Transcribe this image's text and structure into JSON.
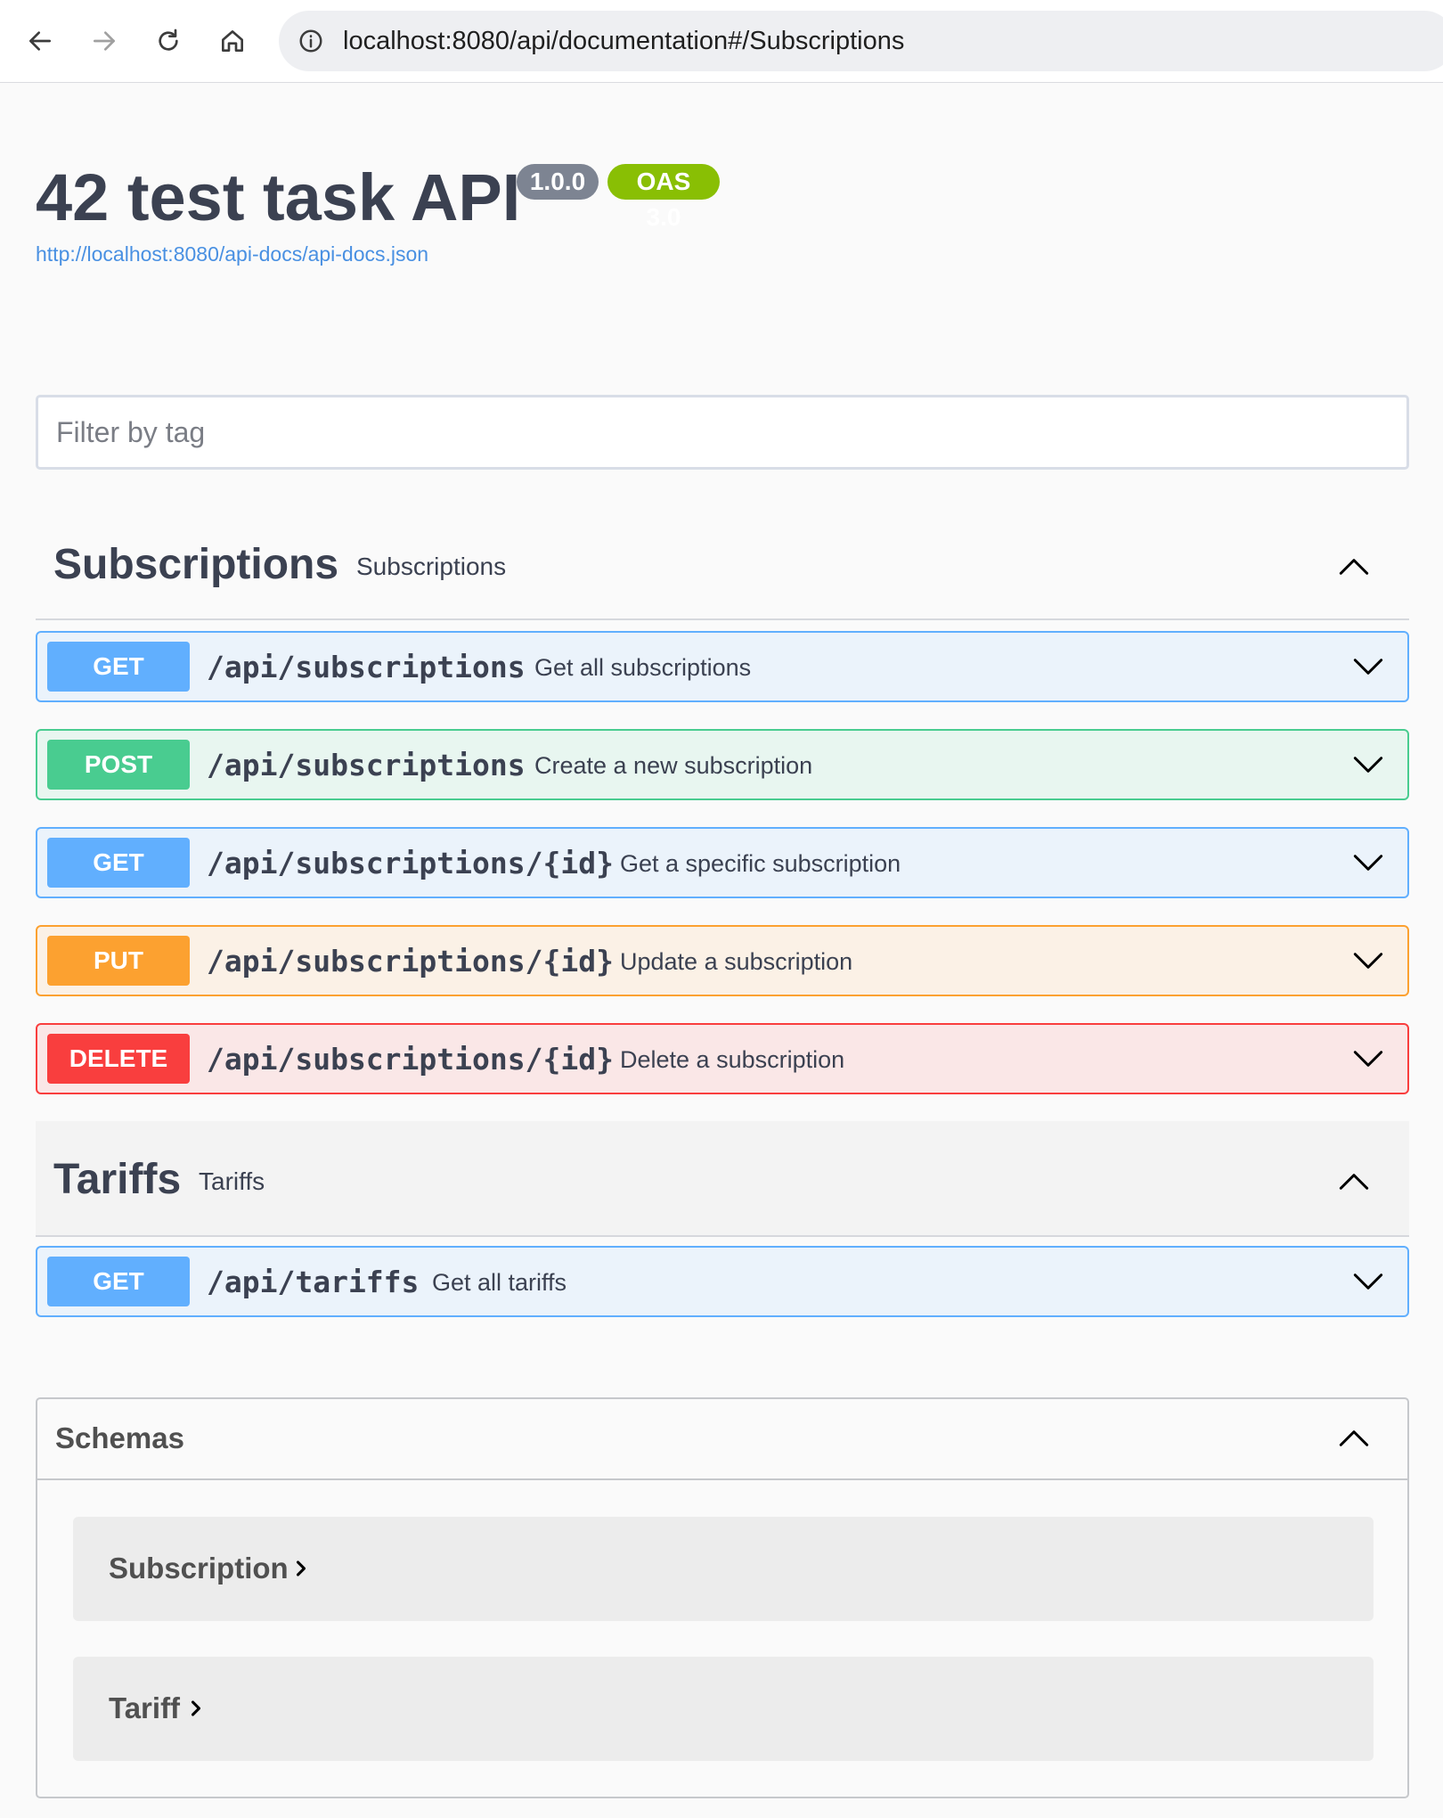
{
  "browser": {
    "url": "localhost:8080/api/documentation#/Subscriptions"
  },
  "info": {
    "title": "42 test task API",
    "version": "1.0.0",
    "oas": "OAS 3.0",
    "spec_url": "http://localhost:8080/api-docs/api-docs.json"
  },
  "filter": {
    "placeholder": "Filter by tag",
    "value": ""
  },
  "tags": [
    {
      "name": "Subscriptions",
      "description": "Subscriptions",
      "operations": [
        {
          "method": "GET",
          "path": "/api/subscriptions",
          "summary": "Get all subscriptions"
        },
        {
          "method": "POST",
          "path": "/api/subscriptions",
          "summary": "Create a new subscription"
        },
        {
          "method": "GET",
          "path": "/api/subscriptions/{id}",
          "summary": "Get a specific subscription"
        },
        {
          "method": "PUT",
          "path": "/api/subscriptions/{id}",
          "summary": "Update a subscription"
        },
        {
          "method": "DELETE",
          "path": "/api/subscriptions/{id}",
          "summary": "Delete a subscription"
        }
      ]
    },
    {
      "name": "Tariffs",
      "description": "Tariffs",
      "operations": [
        {
          "method": "GET",
          "path": "/api/tariffs",
          "summary": "Get all tariffs"
        }
      ]
    }
  ],
  "schemas": {
    "title": "Schemas",
    "items": [
      "Subscription",
      "Tariff"
    ]
  },
  "colors": {
    "get": "#61affe",
    "post": "#49cc90",
    "put": "#fca130",
    "delete": "#f93e3e",
    "version_badge": "#7d8492",
    "oas_badge": "#89bf04",
    "link": "#4990e2"
  },
  "icons": {
    "back": "arrow-left-icon",
    "forward": "arrow-right-icon",
    "reload": "reload-icon",
    "home": "home-icon",
    "site_info": "info-icon",
    "collapse": "chevron-up-icon",
    "expand": "chevron-down-icon",
    "model_expand": "chevron-right-icon"
  }
}
